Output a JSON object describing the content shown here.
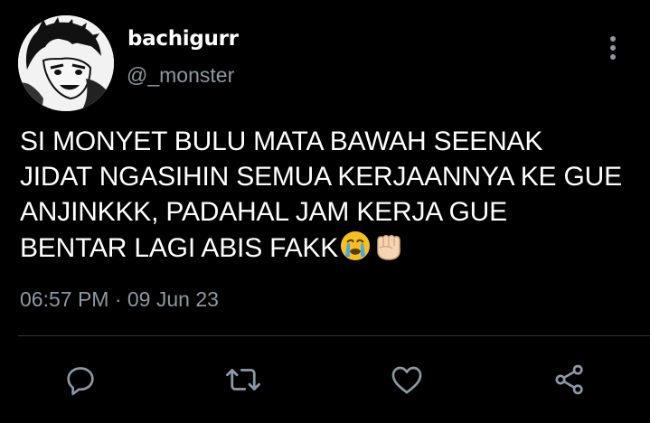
{
  "tweet": {
    "author": {
      "display_name": "bachigurr",
      "handle": "@_monster"
    },
    "text_lines": [
      "SI MONYET BULU MATA BAWAH SEENAK",
      "JIDAT NGASIHIN SEMUA KERJAANNYA KE GUE",
      "ANJINKKK, PADAHAL JAM KERJA GUE",
      "BENTAR LAGI ABIS FAKK"
    ],
    "emojis": [
      "crying-face",
      "fist"
    ],
    "timestamp": "06:57 PM · 09 Jun 23"
  },
  "icons": {
    "more": "more-vertical-icon",
    "reply": "reply-icon",
    "retweet": "retweet-icon",
    "like": "heart-icon",
    "share": "share-icon"
  },
  "colors": {
    "background": "#000000",
    "primary_text": "#ffffff",
    "secondary_text": "#8b98a5",
    "icon": "#8b98a5",
    "divider": "#2f3336"
  }
}
